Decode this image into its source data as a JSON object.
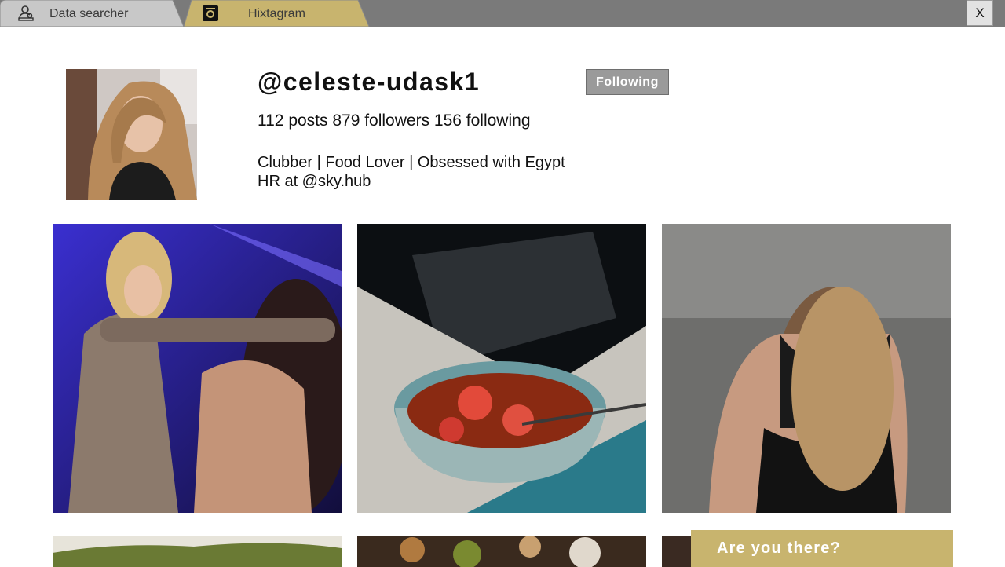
{
  "tabs": [
    {
      "label": "Data searcher",
      "icon": "user-search-icon",
      "color": "#c8c8c8"
    },
    {
      "label": "Hixtagram",
      "icon": "camera-icon",
      "color": "#c8b46e"
    }
  ],
  "window": {
    "close_label": "X"
  },
  "profile": {
    "username": "@celeste-udask1",
    "follow_label": "Following",
    "stats": "112 posts 879 followers 156 following",
    "bio_line1": "Clubber | Food Lover | Obsessed with Egypt",
    "bio_line2": "HR at @sky.hub"
  },
  "toast": {
    "message": "Are you there?"
  },
  "colors": {
    "accent": "#c8b46e",
    "tab_inactive": "#c8c8c8",
    "tabbar": "#7a7a7a",
    "button": "#9a9a9a"
  }
}
